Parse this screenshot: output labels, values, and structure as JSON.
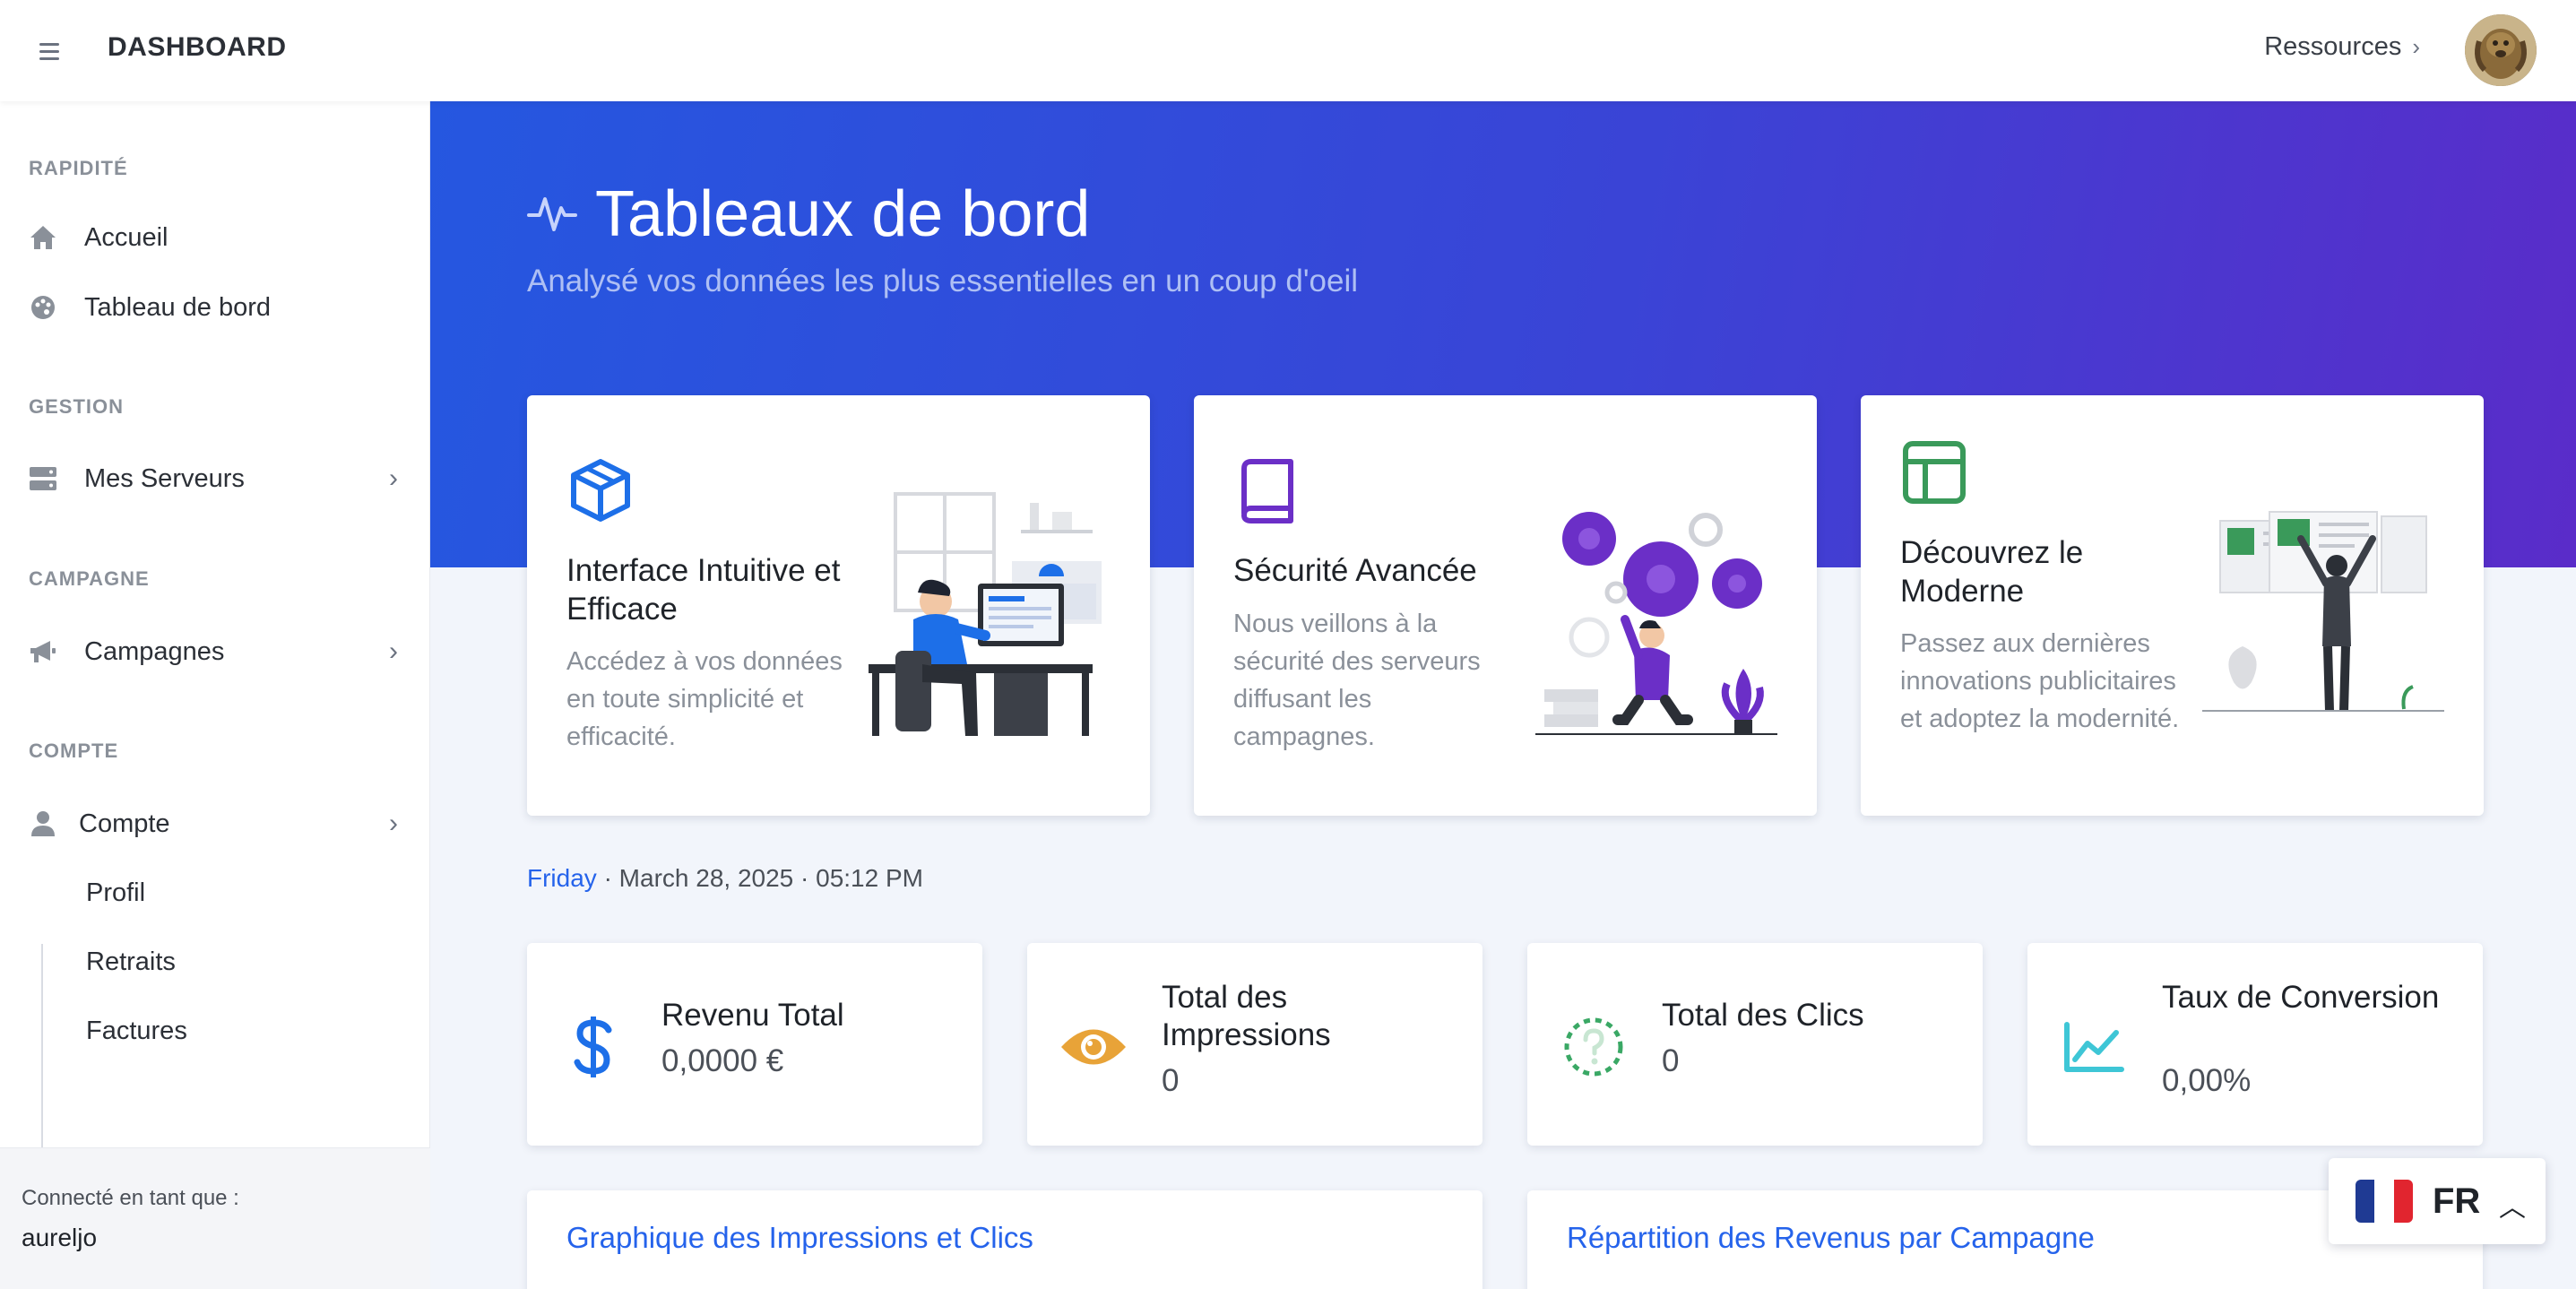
{
  "topbar": {
    "brand": "DASHBOARD",
    "resources_label": "Ressources"
  },
  "sidebar": {
    "sections": [
      {
        "title": "RAPIDITÉ"
      },
      {
        "title": "GESTION"
      },
      {
        "title": "CAMPAGNE"
      },
      {
        "title": "COMPTE"
      }
    ],
    "items": {
      "accueil": "Accueil",
      "tableau": "Tableau de bord",
      "serveurs": "Mes Serveurs",
      "campagnes": "Campagnes",
      "compte": "Compte"
    },
    "sub_items": [
      "Profil",
      "Retraits",
      "Factures"
    ],
    "logged_label": "Connecté en tant que :",
    "username": "aureljo"
  },
  "hero": {
    "title": "Tableaux de bord",
    "subtitle": "Analysé vos données les plus essentielles en un coup d'oeil"
  },
  "features": [
    {
      "title": "Interface Intuitive et Efficace",
      "desc": "Accédez à vos données en toute simplicité et efficacité.",
      "icon": "box-icon",
      "color": "#1d6fe8"
    },
    {
      "title": "Sécurité Avancée",
      "desc": "Nous veillons à la sécurité des serveurs diffusant les campagnes.",
      "icon": "book-icon",
      "color": "#6b2fc7"
    },
    {
      "title": "Découvrez le Moderne",
      "desc": "Passez aux dernières innovations publicitaires et adoptez la modernité.",
      "icon": "layout-icon",
      "color": "#3a9a5a"
    }
  ],
  "datetime": {
    "day": "Friday",
    "rest": "· March 28, 2025 · 05:12 PM"
  },
  "stats": [
    {
      "title": "Revenu Total",
      "value": "0,0000 €",
      "icon": "dollar-icon",
      "color": "#1d6fe8"
    },
    {
      "title": "Total des Impressions",
      "value": "0",
      "icon": "eye-icon",
      "color": "#e8a338"
    },
    {
      "title": "Total des Clics",
      "value": "0",
      "icon": "question-icon",
      "color": "#3aa865"
    },
    {
      "title": "Taux de Conversion",
      "value": "0,00%",
      "icon": "chart-line-icon",
      "color": "#3ec6d6"
    }
  ],
  "panels": {
    "left": "Graphique des Impressions et Clics",
    "right": "Répartition des Revenus par Campagne"
  },
  "language": {
    "code": "FR"
  },
  "colors": {
    "accent": "#2563eb",
    "hero_start": "#2557e0",
    "hero_end": "#5a2cc9"
  }
}
